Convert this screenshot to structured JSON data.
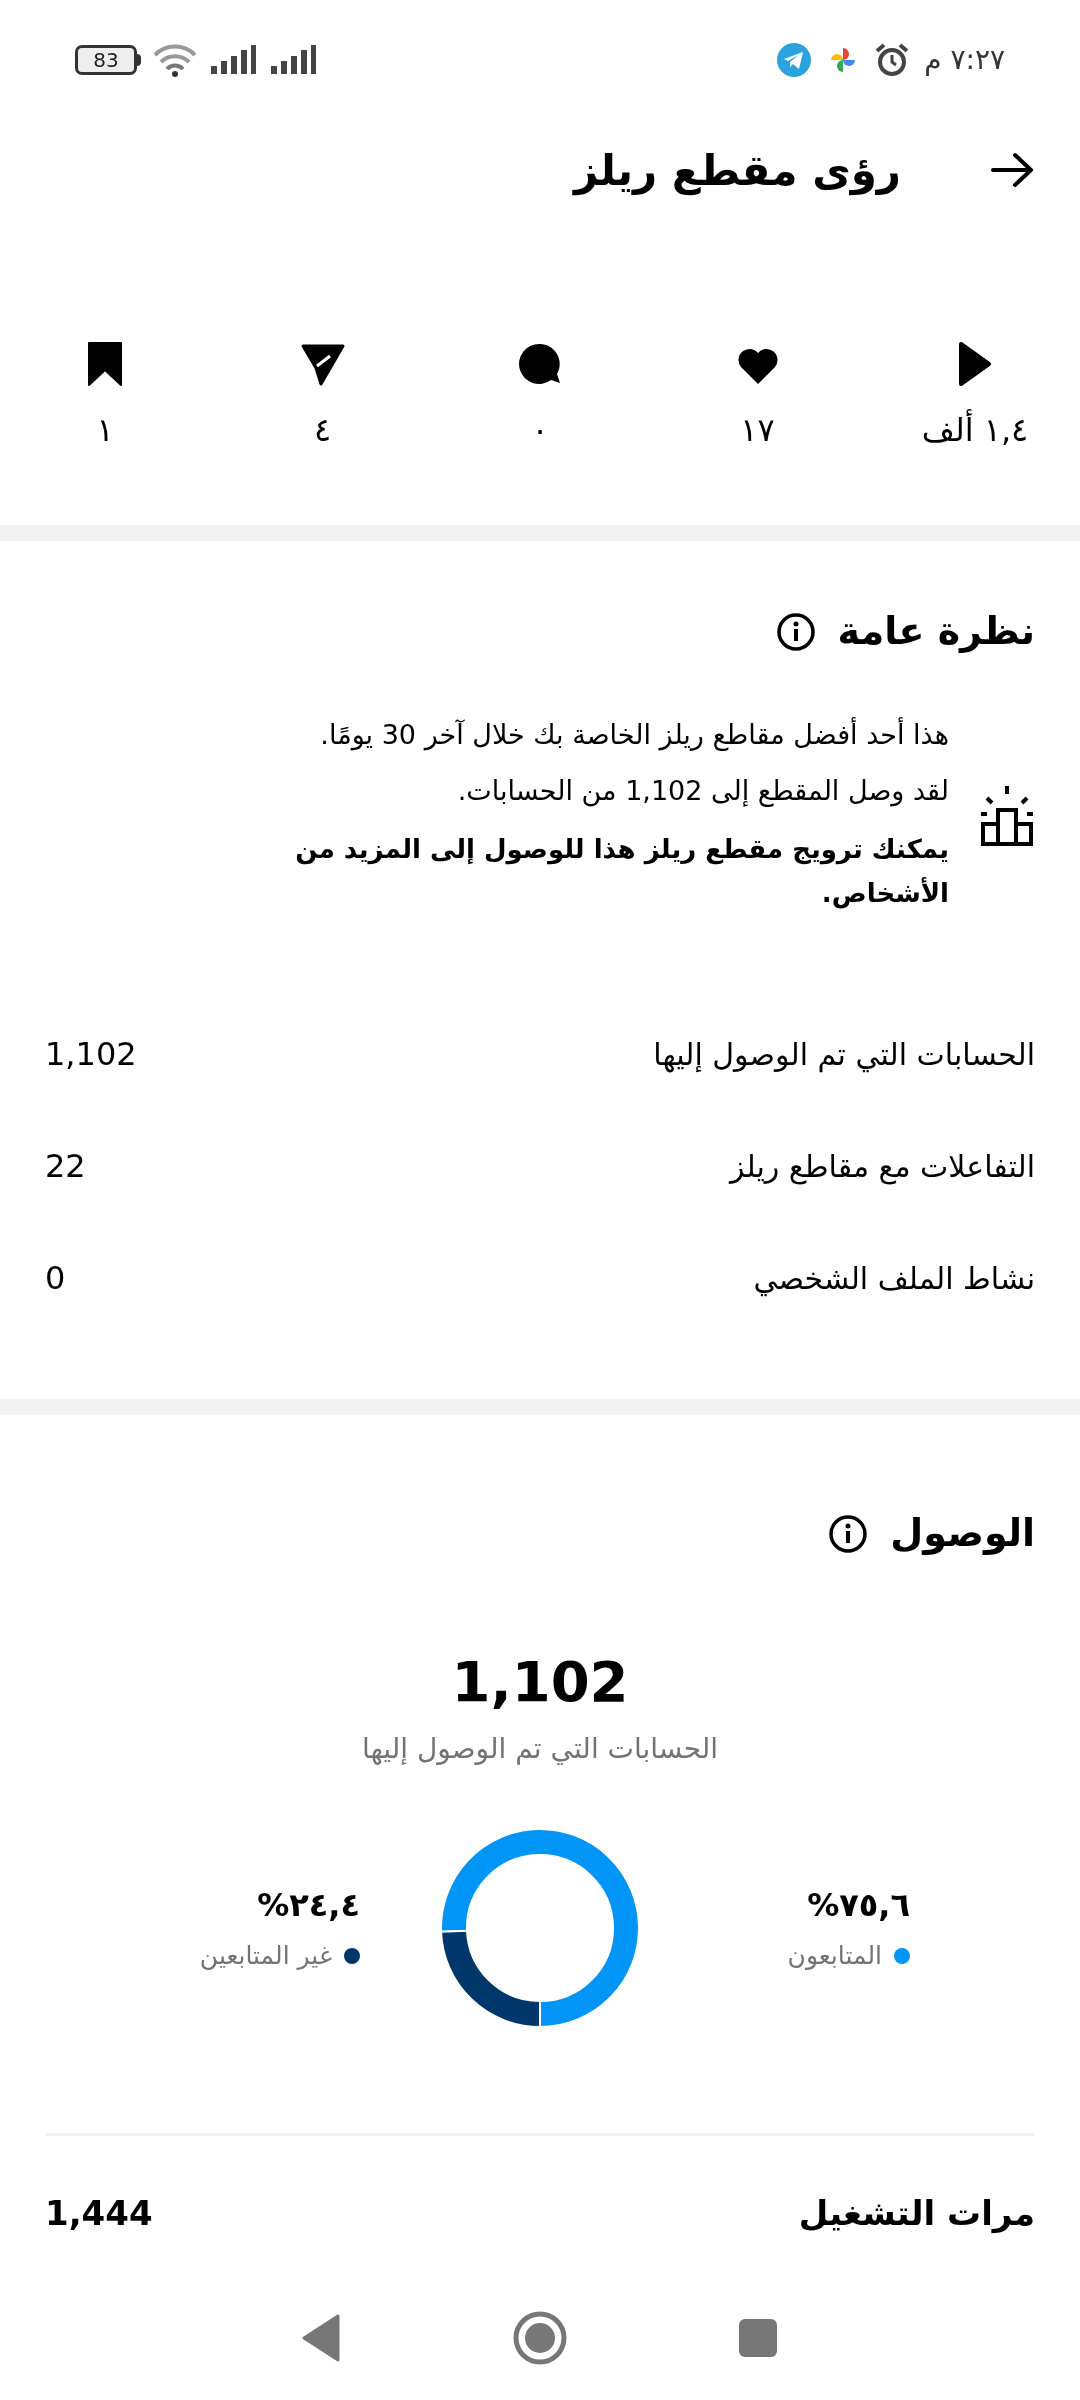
{
  "status_bar": {
    "time": "٧:٢٧ م",
    "battery": "83"
  },
  "header": {
    "title": "رؤى مقطع ريلز"
  },
  "stats": [
    {
      "kind": "plays",
      "value": "١,٤ ألف"
    },
    {
      "kind": "likes",
      "value": "١٧"
    },
    {
      "kind": "comments",
      "value": "٠"
    },
    {
      "kind": "shares",
      "value": "٤"
    },
    {
      "kind": "saves",
      "value": "١"
    }
  ],
  "overview": {
    "title": "نظرة عامة",
    "messages": [
      {
        "text": "هذا أحد أفضل مقاطع ريلز الخاصة بك خلال آخر 30 يومًا.",
        "bold": false
      },
      {
        "text": "لقد وصل المقطع إلى 1,102 من الحسابات.",
        "bold": false
      },
      {
        "text": "يمكنك ترويج مقطع ريلز هذا للوصول إلى المزيد من الأشخاص.",
        "bold": true
      }
    ],
    "metrics": [
      {
        "label": "الحسابات التي تم الوصول إليها",
        "value": "1,102"
      },
      {
        "label": "التفاعلات مع مقاطع ريلز",
        "value": "22"
      },
      {
        "label": "نشاط الملف الشخصي",
        "value": "0"
      }
    ]
  },
  "reach": {
    "title": "الوصول",
    "total": "1,102",
    "total_label": "الحسابات التي تم الوصول إليها",
    "chart_data": {
      "type": "donut",
      "categories": [
        "المتابعون",
        "غير المتابعين"
      ],
      "values": [
        75.6,
        24.4
      ]
    },
    "legend": [
      {
        "percent": "٧٥,٦%",
        "color": "#0095f6"
      },
      {
        "percent": "٢٤,٤%",
        "color": "#00376b"
      }
    ],
    "metrics": [
      {
        "label": "مرات التشغيل",
        "value": "1,444"
      }
    ]
  }
}
